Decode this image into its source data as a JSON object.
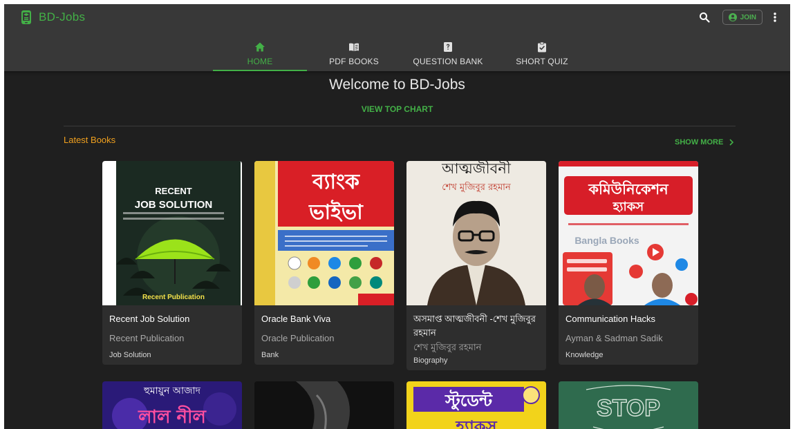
{
  "brand": {
    "name": "BD-Jobs"
  },
  "header": {
    "join_label": "JOIN"
  },
  "tabs": [
    {
      "label": "HOME",
      "icon": "home-icon",
      "active": true
    },
    {
      "label": "PDF BOOKS",
      "icon": "book-icon",
      "active": false
    },
    {
      "label": "QUESTION BANK",
      "icon": "question-icon",
      "active": false
    },
    {
      "label": "SHORT QUIZ",
      "icon": "clipboard-check-icon",
      "active": false
    }
  ],
  "main": {
    "welcome": "Welcome to BD-Jobs",
    "top_chart": "VIEW TOP CHART",
    "section_title": "Latest Books",
    "show_more": "SHOW MORE"
  },
  "books": [
    {
      "title": "Recent Job Solution",
      "author": "Recent Publication",
      "category": "Job Solution",
      "cover_lines": [
        "RECENT",
        "JOB SOLUTION",
        "Recent Publication"
      ]
    },
    {
      "title": "Oracle Bank Viva",
      "author": "Oracle Publication",
      "category": "Bank",
      "cover_lines": [
        "ব্যাংক",
        "ভাইভা"
      ]
    },
    {
      "title": "অসমাপ্ত আত্মজীবনী -শেখ মুজিবুর রহমান",
      "author": "শেখ মুজিবুর রহমান",
      "category": "Biography",
      "cover_lines": [
        "আত্মজীবনী",
        "শেখ মুজিবুর রহমান"
      ]
    },
    {
      "title": "Communication Hacks",
      "author": "Ayman & Sadman Sadik",
      "category": "Knowledge",
      "cover_lines": [
        "কমিউনিকেশন",
        "হ্যাকস",
        "Bangla Books"
      ]
    }
  ],
  "more_books": [
    {
      "cover_lines": [
        "হুমায়ুন আজাদ",
        "লাল নীল"
      ]
    },
    {
      "cover_lines": []
    },
    {
      "cover_lines": [
        "স্টুডেন্ট",
        "হ্যাকস"
      ]
    },
    {
      "cover_lines": [
        "STOP"
      ]
    }
  ],
  "colors": {
    "accent": "#43b047",
    "section": "#f0a01f",
    "appbar": "#383838",
    "background": "#1f1f1f",
    "card": "#2e2e2e"
  }
}
